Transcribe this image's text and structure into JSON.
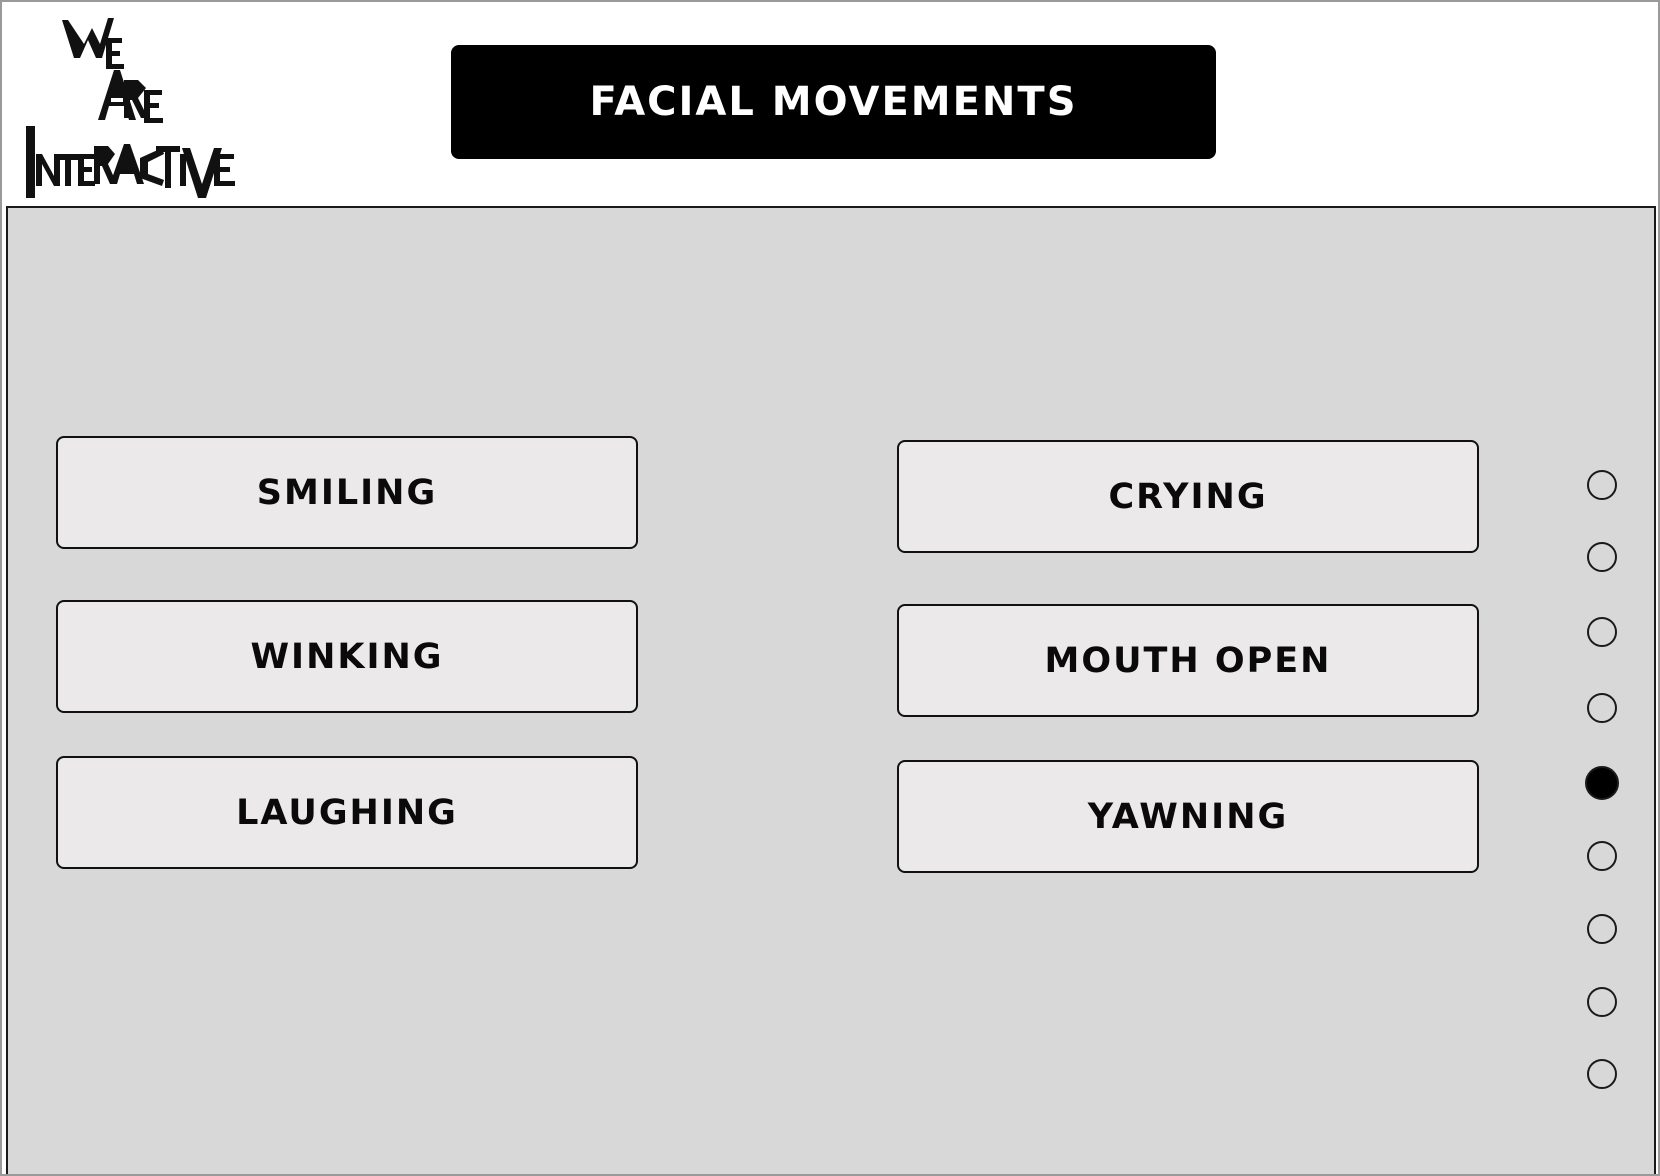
{
  "header": {
    "logo_text": [
      "WE",
      "ARE",
      "INTERACTIVE"
    ],
    "title": "FACIAL MOVEMENTS"
  },
  "options": {
    "left": [
      {
        "label": "SMILING"
      },
      {
        "label": "WINKING"
      },
      {
        "label": "LAUGHING"
      }
    ],
    "right": [
      {
        "label": "CRYING"
      },
      {
        "label": "MOUTH OPEN"
      },
      {
        "label": "YAWNING"
      }
    ]
  },
  "pagination": {
    "total_pages": 9,
    "current_page": 5
  },
  "colors": {
    "title_bar": "#000000",
    "title_text": "#ffffff",
    "main_background": "#d8d8d8",
    "button_background": "#ebe9ea",
    "button_border": "#111111"
  }
}
